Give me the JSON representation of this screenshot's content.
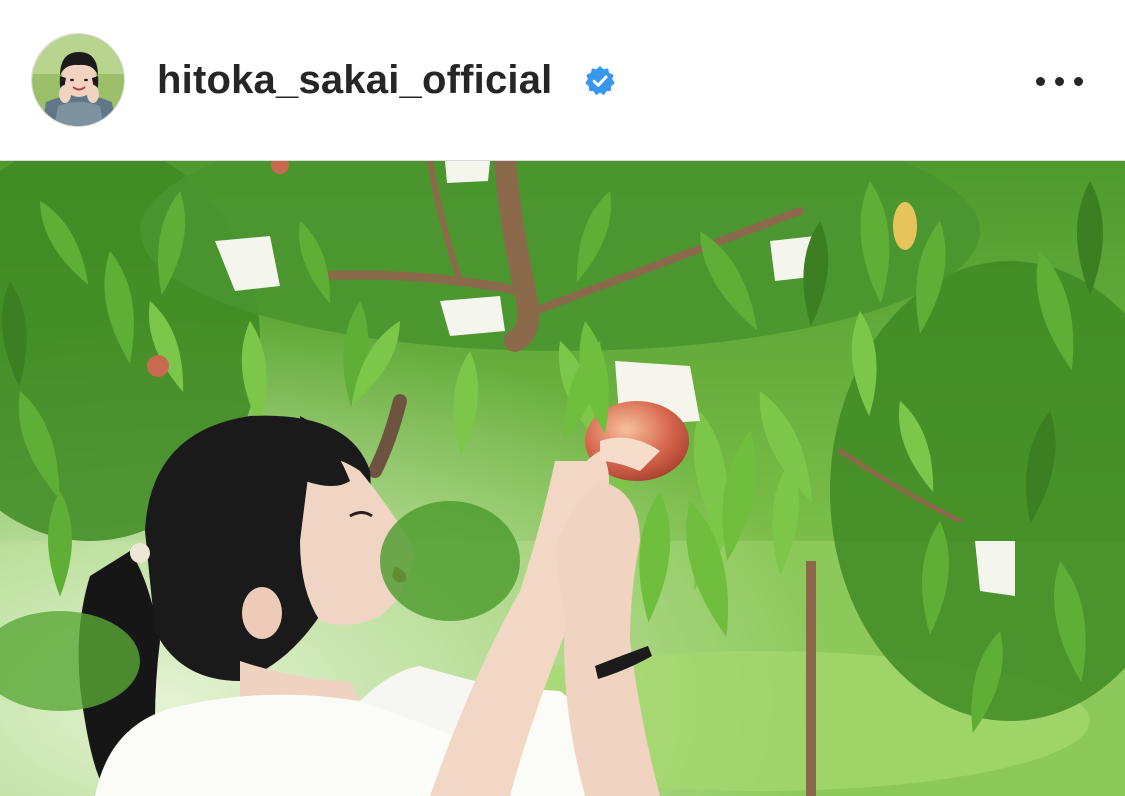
{
  "post": {
    "author": {
      "username": "hitoka_sakai_official",
      "verified": true,
      "avatar_icon": "profile-photo-avatar",
      "verified_icon": "verified-badge-icon",
      "verified_color": "#3897f0"
    },
    "menu_icon": "more-options-icon",
    "photo": {
      "subject": "woman picking a peach from a tree in an orchard"
    }
  },
  "colors": {
    "text": "#262626",
    "divider": "#dbdbdb",
    "background": "#ffffff",
    "verified_blue": "#3897f0"
  }
}
